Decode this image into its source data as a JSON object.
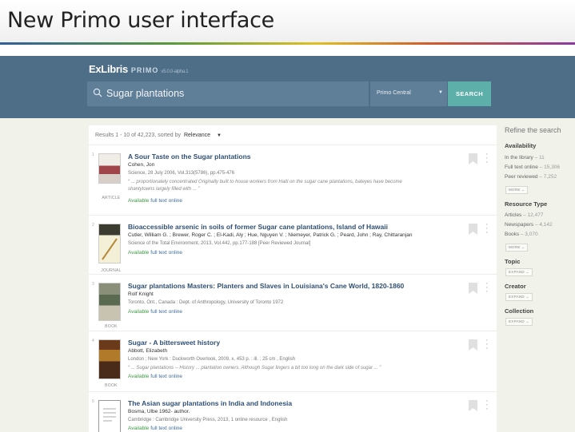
{
  "slide": {
    "title": "New Primo user interface"
  },
  "header": {
    "logo": "ExLibris",
    "product": "PRIMO",
    "version": "v5.0.0-alpha.1",
    "search_value": "Sugar plantations",
    "scope": "Primo Central",
    "search_button": "SEARCH"
  },
  "results": {
    "summary_prefix": "Results 1 - 10 of 42,223, sorted by",
    "sort_value": "Relevance",
    "items": [
      {
        "number": "1",
        "title": "A Sour Taste on the Sugar plantations",
        "author": "Cohen, Jon",
        "source": "Science, 28 July 2006, Vol.313(5786), pp.475-476",
        "snippet": "“ ... proportionately concentrated   Originally built to house workers from Haiti on the sugar cane plantations, bateyes have become shantytowns largely filled with ... ”",
        "type": "ARTICLE",
        "available": "Available",
        "fulltext": "full text online"
      },
      {
        "number": "2",
        "title": "Bioaccessible arsenic in soils of former Sugar cane plantations, Island of Hawaii",
        "author": "Cutler, William G. ; Brewer, Roger C. ; El-Kadi, Aly ; Hue, Nguyen V. ; Niemeyer, Patrick G. ; Peard, John ; Ray, Chittaranjan",
        "source": "Science of the Total Environment, 2013, Vol.442, pp.177-188 [Peer Reviewed Journal]",
        "snippet": "",
        "type": "JOURNAL",
        "available": "Available",
        "fulltext": "full text online"
      },
      {
        "number": "3",
        "title": "Sugar plantations Masters: Planters and Slaves in Louisiana's Cane World, 1820-1860",
        "author": "Rolf Knight",
        "source": "Toronto, Ont., Canada : Dept. of Anthropology, University of Toronto 1972",
        "snippet": "",
        "type": "BOOK",
        "available": "Available",
        "fulltext": "full text online"
      },
      {
        "number": "4",
        "title": "Sugar - A bittersweet history",
        "author": "Abbott, Elizabeth",
        "source": "London ; New York : Duckworth Overlook, 2009, x, 453 p. : ill. ; 25 cm , English",
        "snippet": "“ ... Sugar plantations -- History ... plantation owners. Although Sugar lingers a bit too long on the dark side of sugar ... ”",
        "type": "BOOK",
        "available": "Available",
        "fulltext": "full text online"
      },
      {
        "number": "5",
        "title": "The Asian sugar plantations in India and Indonesia",
        "author": "Bosma, Ulbe 1962- author.",
        "source": "Cambridge : Cambridge University Press, 2013, 1 online resource , English",
        "snippet": "",
        "type": "BOOK",
        "available": "Available",
        "fulltext": "full text online"
      }
    ]
  },
  "refine": {
    "title": "Refine the search",
    "availability": {
      "heading": "Availability",
      "lines": [
        {
          "label": "In the library",
          "count": "– 11"
        },
        {
          "label": "Full text online",
          "count": "– 15,306"
        },
        {
          "label": "Peer reviewed",
          "count": "– 7,252"
        }
      ],
      "more": "MORE ⌄"
    },
    "resource_type": {
      "heading": "Resource Type",
      "lines": [
        {
          "label": "Articles",
          "count": "– 12,477"
        },
        {
          "label": "Newspapers",
          "count": "– 4,142"
        },
        {
          "label": "Books",
          "count": "– 3,070"
        }
      ],
      "more": "MORE ⌄"
    },
    "topic": {
      "heading": "Topic",
      "expand": "EXPAND ⌄"
    },
    "creator": {
      "heading": "Creator",
      "expand": "EXPAND ⌄"
    },
    "collection": {
      "heading": "Collection",
      "expand": "EXPAND ⌄"
    }
  },
  "icons": [
    "search-icon",
    "bookmark-icon",
    "more-options-icon",
    "dropdown-caret-icon"
  ],
  "colors": {
    "header": "#4e6e88",
    "search_button": "#5cb0a9",
    "title_link": "#2f4f75",
    "available": "#3a9a40"
  }
}
